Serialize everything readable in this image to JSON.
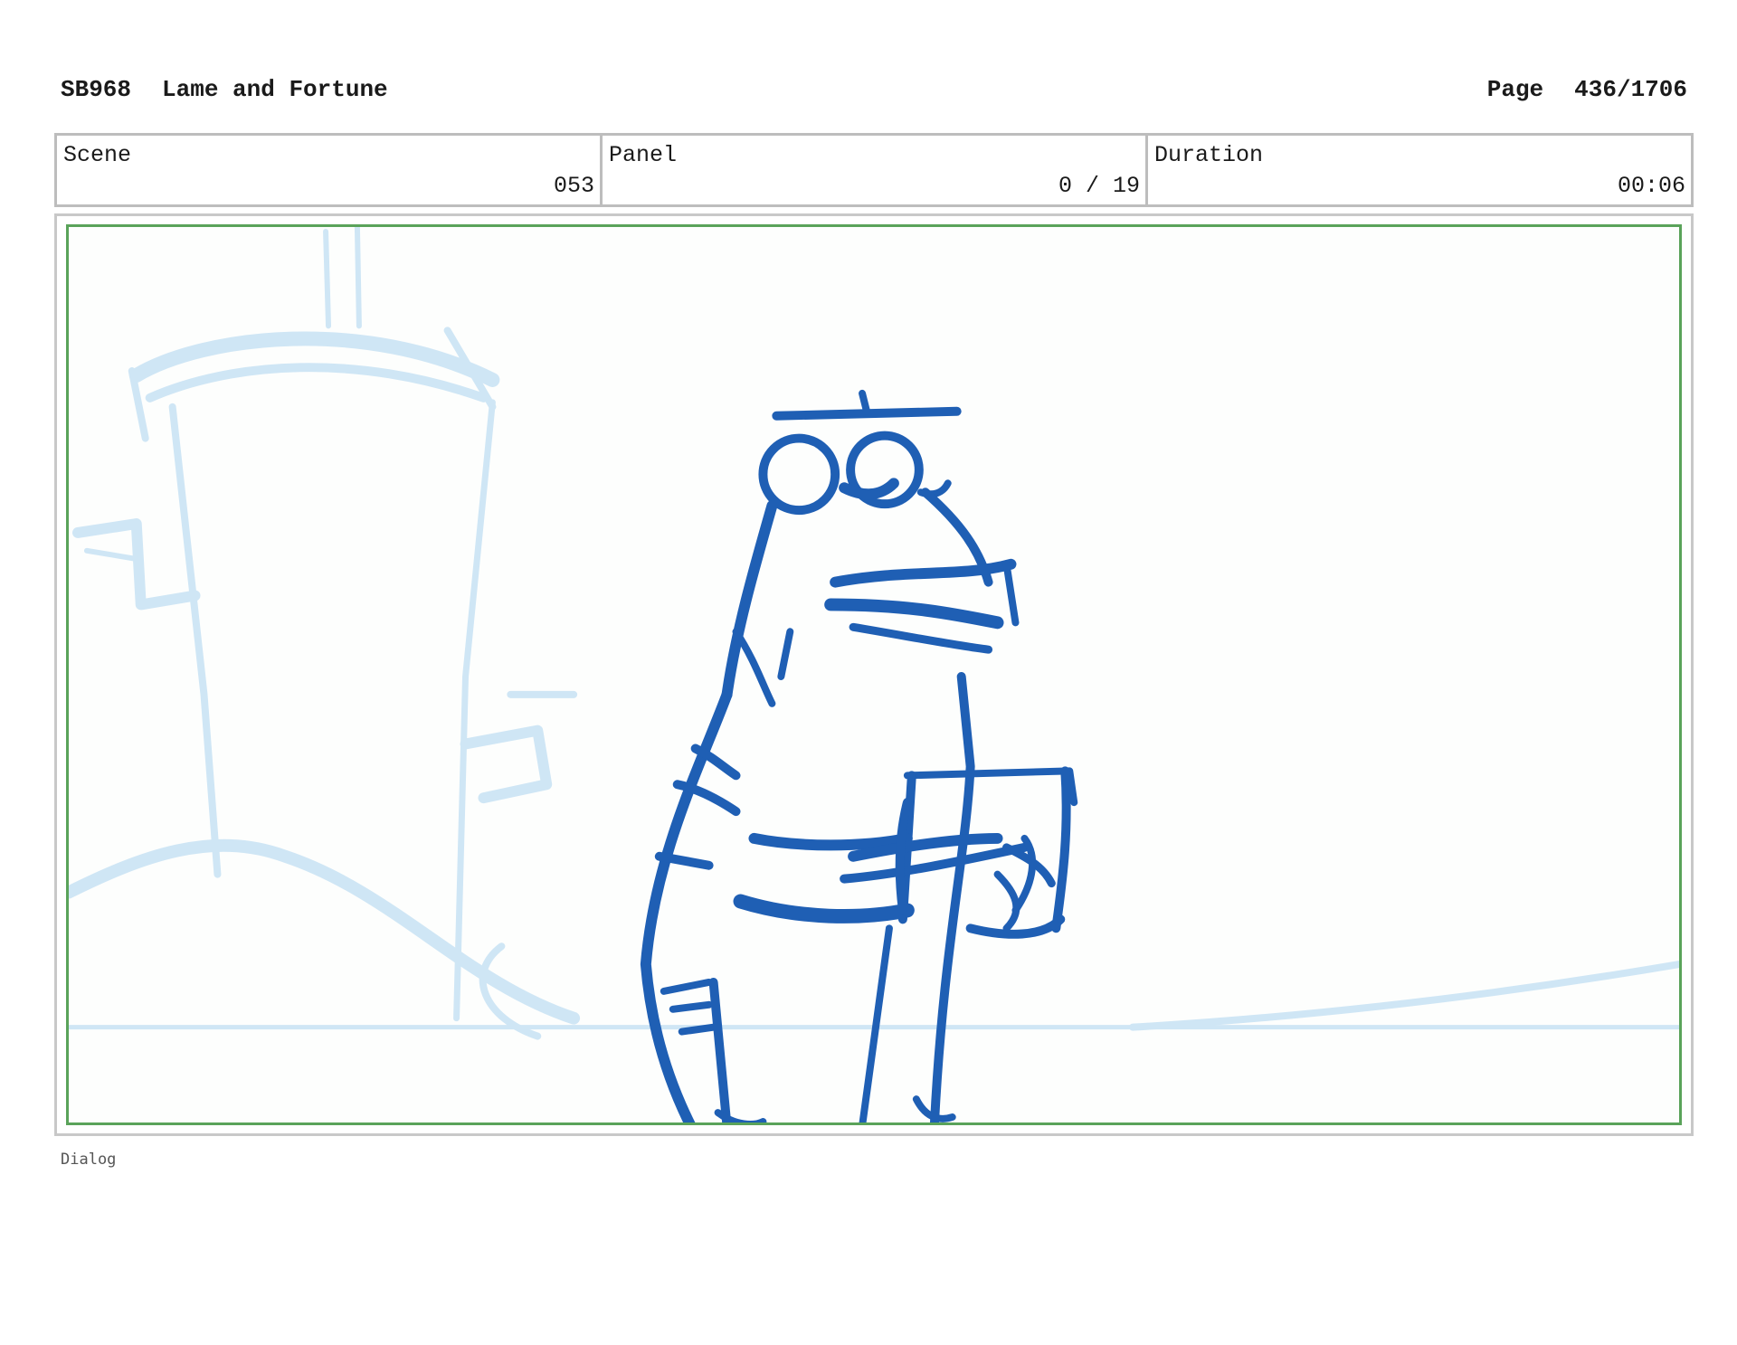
{
  "header": {
    "id": "SB968",
    "title": "Lame and Fortune",
    "page_label": "Page",
    "page_value": "436/1706"
  },
  "info": {
    "scene_label": "Scene",
    "scene_value": "053",
    "panel_label": "Panel",
    "panel_value": "0 / 19",
    "duration_label": "Duration",
    "duration_value": "00:06"
  },
  "dialog": {
    "label": "Dialog"
  },
  "colors": {
    "sketch_primary": "#1f5fb4",
    "sketch_background": "#cfe6f5",
    "frame_green": "#5aa35a"
  }
}
